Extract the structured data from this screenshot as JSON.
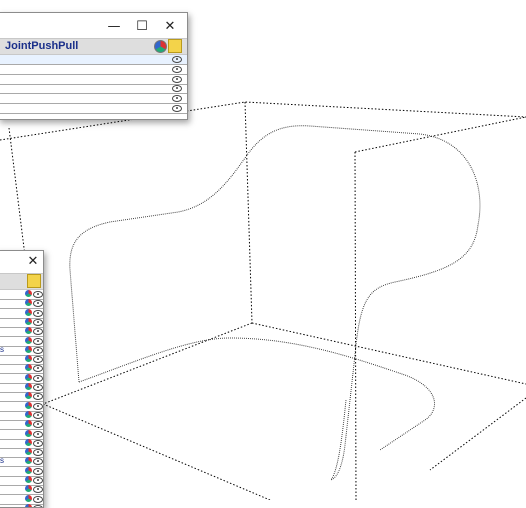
{
  "panel_top": {
    "header_title": "JointPushPull",
    "minimize_glyph": "—",
    "maximize_glyph": "☐",
    "close_glyph": "✕",
    "row_count": 6
  },
  "panel_left": {
    "close_glyph": "✕",
    "row_count": 24,
    "letter_rows": [
      {
        "row": 6,
        "text": "s"
      },
      {
        "row": 18,
        "text": "s"
      }
    ]
  },
  "icons": [
    "eye-icon",
    "paint-icon",
    "wrench-icon"
  ],
  "colors": {
    "header_title": "#1a2f8a",
    "selected_row": "#e8f2ff",
    "canvas_line": "#000000"
  }
}
